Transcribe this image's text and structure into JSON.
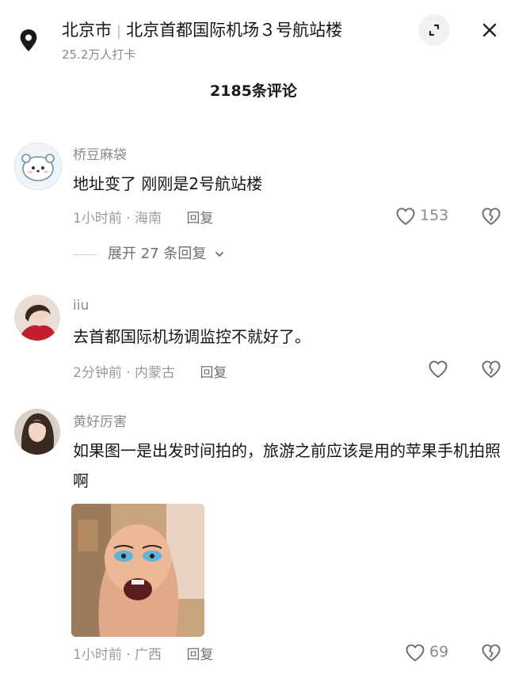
{
  "header": {
    "city": "北京市",
    "place": "北京首都国际机场３号航站楼",
    "checkins": "25.2万人打卡"
  },
  "comment_count": "2185条评论",
  "comments": [
    {
      "user": "桥豆麻袋",
      "text": "地址变了 刚刚是2号航站楼",
      "time_location": "1小时前 · 海南",
      "reply_label": "回复",
      "likes": "153",
      "expand_replies": "展开 27 条回复"
    },
    {
      "user": "iiu",
      "text": "去首都国际机场调监控不就好了。",
      "time_location": "2分钟前 · 内蒙古",
      "reply_label": "回复",
      "likes": ""
    },
    {
      "user": "黄好厉害",
      "text": "如果图一是出发时间拍的，旅游之前应该是用的苹果手机拍照啊",
      "time_location": "1小时前 · 广西",
      "reply_label": "回复",
      "likes": "69"
    }
  ],
  "colors": {
    "text_primary": "#161616",
    "text_secondary": "#8a8a8a",
    "background": "#ffffff"
  },
  "icons": [
    "location-pin-icon",
    "expand-icon",
    "close-icon",
    "heart-icon",
    "broken-heart-icon",
    "chevron-down-icon"
  ]
}
